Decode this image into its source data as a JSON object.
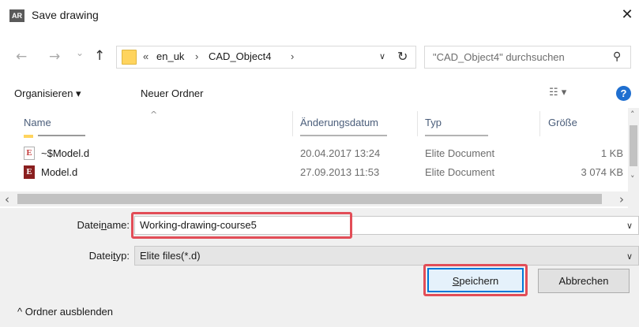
{
  "window": {
    "app_badge": "AR",
    "title": "Save drawing",
    "close_glyph": "✕"
  },
  "nav": {
    "back_glyph": "←",
    "forward_glyph": "→",
    "recent_glyph": "⌄",
    "up_glyph": "↑",
    "breadcrumb": {
      "prefix": "«",
      "segment1": "en_uk",
      "sep": "›",
      "segment2": "CAD_Object4",
      "sep2": "›"
    },
    "dropdown_glyph": "∨",
    "refresh_glyph": "↻"
  },
  "search": {
    "placeholder": "\"CAD_Object4\" durchsuchen",
    "icon_glyph": "⚲"
  },
  "toolbar": {
    "organize_label": "Organisieren ▾",
    "new_folder_label": "Neuer Ordner",
    "view_glyph": "☷ ▾",
    "help_glyph": "?"
  },
  "file_list": {
    "columns": {
      "name": "Name",
      "date": "Änderungsdatum",
      "type": "Typ",
      "size": "Größe"
    },
    "sort_glyph": "^",
    "rows": [
      {
        "icon": "E",
        "name": "~$Model.d",
        "date": "20.04.2017 13:24",
        "type": "Elite Document",
        "size": "1 KB"
      },
      {
        "icon": "E",
        "name": "Model.d",
        "date": "27.09.2013 11:53",
        "type": "Elite Document",
        "size": "3 074 KB"
      }
    ],
    "scroll_left": "‹",
    "scroll_right": "›",
    "scroll_up": "˄",
    "scroll_down": "˅"
  },
  "form": {
    "filename_label_pre": "Datei",
    "filename_label_u": "n",
    "filename_label_post": "ame:",
    "filename_value": "Working-drawing-course5",
    "filetype_label_pre": "Datei",
    "filetype_label_u": "t",
    "filetype_label_post": "yp:",
    "filetype_value": "Elite files(*.d)",
    "chevron": "∨"
  },
  "footer": {
    "hide_folders_label": "^  Ordner ausblenden",
    "save_pre": "",
    "save_u": "S",
    "save_post": "peichern",
    "cancel_label": "Abbrechen"
  },
  "colors": {
    "highlight": "#e24d57",
    "primary_border": "#0078d7",
    "help_blue": "#1f6fd0"
  }
}
